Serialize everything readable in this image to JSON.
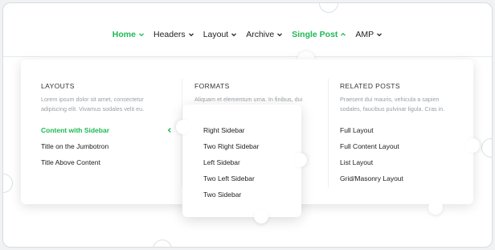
{
  "nav": {
    "items": [
      {
        "label": "Home",
        "state": "active"
      },
      {
        "label": "Headers",
        "state": ""
      },
      {
        "label": "Layout",
        "state": ""
      },
      {
        "label": "Archive",
        "state": ""
      },
      {
        "label": "Single Post",
        "state": "open"
      },
      {
        "label": "AMP",
        "state": ""
      }
    ]
  },
  "mega": {
    "layouts": {
      "heading": "LAYOUTS",
      "desc_line1": "Lorem ipsum dolor sit amet, consectetur",
      "desc_line2": "adipiscing elit. Vivamus sodales velit eu.",
      "links": [
        "Content with Sidebar",
        "Title on the Jumbotron",
        "Title Above Content"
      ]
    },
    "formats": {
      "heading": "FORMATS",
      "desc_line1": "Aliquam et elementum urna. In finibus, dui"
    },
    "related": {
      "heading": "RELATED POSTS",
      "desc_line1": "Praesent dui mauris, vehicula a sapien",
      "desc_line2": "sodales, faucibus pulvinar ligula. Cras in.",
      "links": [
        "Full Layout",
        "Full Content Layout",
        "List Layout",
        "Grid/Masonry Layout"
      ]
    }
  },
  "submenu": {
    "links": [
      "Right Sidebar",
      "Two Right Sidebar",
      "Left Sidebar",
      "Two Left Sidebar",
      "Two Sidebar"
    ]
  },
  "colors": {
    "accent": "#1db954",
    "text": "#222222",
    "muted": "#9aa0a6"
  }
}
